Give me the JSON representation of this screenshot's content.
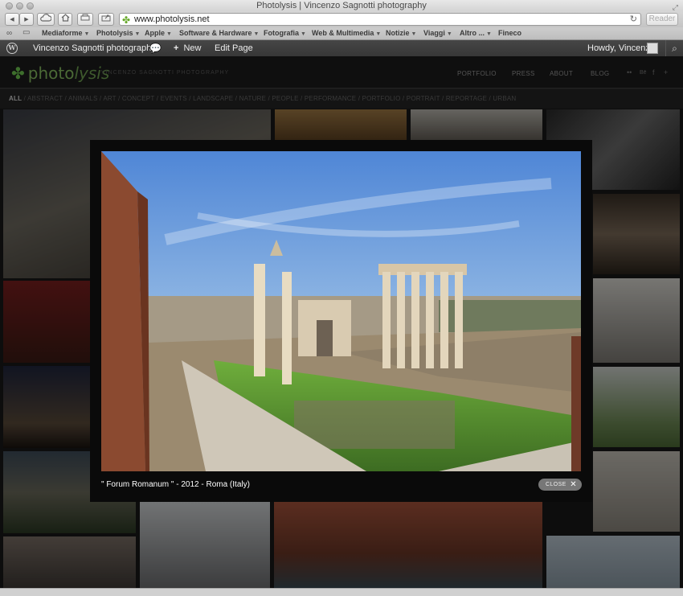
{
  "window": {
    "title": "Photolysis | Vincenzo Sagnotti photography"
  },
  "toolbar": {
    "back": "◀",
    "forward": "▶",
    "url": "www.photolysis.net",
    "reader_label": "Reader"
  },
  "bookmarks": [
    {
      "label": "Mediaforme",
      "menu": true
    },
    {
      "label": "Photolysis",
      "menu": true
    },
    {
      "label": "Apple",
      "menu": true
    },
    {
      "label": "Software & Hardware",
      "menu": true
    },
    {
      "label": "Fotografia",
      "menu": true
    },
    {
      "label": "Web & Multimedia",
      "menu": true
    },
    {
      "label": "Notizie",
      "menu": true
    },
    {
      "label": "Viaggi",
      "menu": true
    },
    {
      "label": "Altro ...",
      "menu": true
    },
    {
      "label": "Fineco",
      "menu": false
    }
  ],
  "wpbar": {
    "site_name": "Vincenzo Sagnotti photography",
    "new_label": "New",
    "edit_label": "Edit Page",
    "howdy": "Howdy, Vincenzo"
  },
  "site": {
    "logo_main": "photo",
    "logo_accent": "lysis",
    "tagline": "VINCENZO SAGNOTTI PHOTOGRAPHY",
    "nav": [
      "PORTFOLIO",
      "PRESS",
      "ABOUT",
      "BLOG"
    ]
  },
  "filters": [
    "ALL",
    "ABSTRACT",
    "ANIMALS",
    "ART",
    "CONCEPT",
    "EVENTS",
    "LANDSCAPE",
    "NATURE",
    "PEOPLE",
    "PERFORMANCE",
    "PORTFOLIO",
    "PORTRAIT",
    "REPORTAGE",
    "URBAN"
  ],
  "lightbox": {
    "caption": "\" Forum Romanum \" - 2012 - Roma (Italy)",
    "close_label": "CLOSE"
  },
  "colors": {
    "wp_bar": "#3f3f3f",
    "logo_green": "#4b6a36",
    "lightbox_bg": "#0a0a0a"
  }
}
